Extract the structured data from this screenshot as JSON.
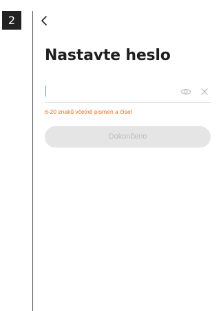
{
  "step": {
    "number": "2"
  },
  "icons": {
    "back": "chevron-left-icon",
    "show_password": "eye-icon",
    "clear": "close-icon"
  },
  "header": {
    "title": "Nastavte heslo"
  },
  "password": {
    "value": "",
    "placeholder": ""
  },
  "hint": {
    "text": "6-20 znaků včetně písmen a čísel"
  },
  "actions": {
    "done_label": "Dokončeno"
  },
  "colors": {
    "caret": "#1fb7d8",
    "hint": "#f06a1a",
    "button_bg": "#e5e5e5",
    "button_text": "#bdbdbd",
    "title": "#1f1f1f"
  }
}
